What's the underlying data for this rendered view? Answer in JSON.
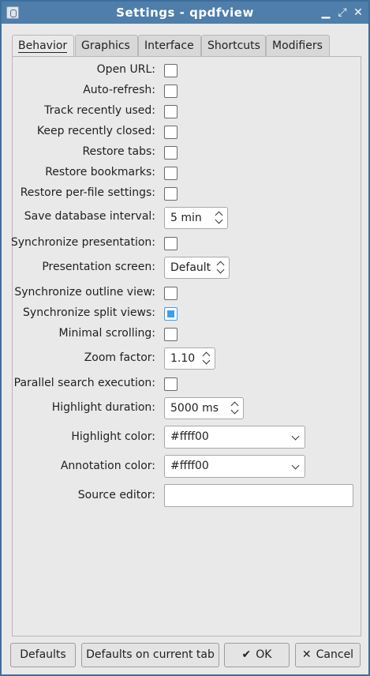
{
  "window": {
    "title": "Settings - qpdfview",
    "app_icon": "qpdfview-icon",
    "controls": {
      "minimize": "▁",
      "restore": "⤢",
      "close": "✕"
    }
  },
  "tabs": [
    {
      "label": "Behavior",
      "active": true
    },
    {
      "label": "Graphics",
      "active": false
    },
    {
      "label": "Interface",
      "active": false
    },
    {
      "label": "Shortcuts",
      "active": false
    },
    {
      "label": "Modifiers",
      "active": false
    }
  ],
  "behavior": {
    "open_url": {
      "label": "Open URL:",
      "checked": false
    },
    "auto_refresh": {
      "label": "Auto-refresh:",
      "checked": false
    },
    "track_recently_used": {
      "label": "Track recently used:",
      "checked": false
    },
    "keep_recently_closed": {
      "label": "Keep recently closed:",
      "checked": false
    },
    "restore_tabs": {
      "label": "Restore tabs:",
      "checked": false
    },
    "restore_bookmarks": {
      "label": "Restore bookmarks:",
      "checked": false
    },
    "restore_per_file": {
      "label": "Restore per-file settings:",
      "checked": false
    },
    "save_db_interval": {
      "label": "Save database interval:",
      "value": "5 min"
    },
    "sync_presentation": {
      "label": "Synchronize presentation:",
      "checked": false
    },
    "presentation_screen": {
      "label": "Presentation screen:",
      "value": "Default"
    },
    "sync_outline": {
      "label": "Synchronize outline view:",
      "checked": false
    },
    "sync_split": {
      "label": "Synchronize split views:",
      "checked": true
    },
    "minimal_scrolling": {
      "label": "Minimal scrolling:",
      "checked": false
    },
    "zoom_factor": {
      "label": "Zoom factor:",
      "value": "1.10"
    },
    "parallel_search": {
      "label": "Parallel search execution:",
      "checked": false
    },
    "highlight_duration": {
      "label": "Highlight duration:",
      "value": "5000 ms"
    },
    "highlight_color": {
      "label": "Highlight color:",
      "value": "#ffff00"
    },
    "annotation_color": {
      "label": "Annotation color:",
      "value": "#ffff00"
    },
    "source_editor": {
      "label": "Source editor:",
      "value": "",
      "placeholder": ""
    }
  },
  "buttons": {
    "defaults": "Defaults",
    "defaults_current_tab": "Defaults on current tab",
    "ok": "OK",
    "ok_icon": "✔",
    "cancel": "Cancel",
    "cancel_icon": "✕"
  },
  "colors": {
    "titlebar": "#4e7ea9",
    "checked_accent": "#3f9ee8"
  }
}
